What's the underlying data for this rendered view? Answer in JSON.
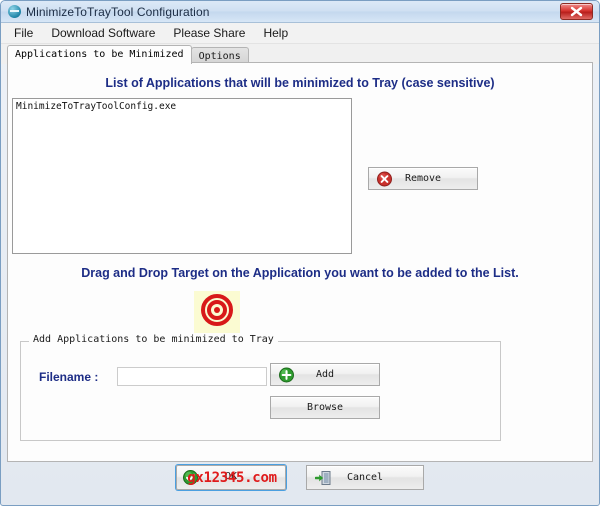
{
  "window": {
    "title": "MinimizeToTrayTool Configuration",
    "app_icon": "app-circle-icon",
    "close_icon": "close-icon"
  },
  "menubar": {
    "items": [
      {
        "label": "File"
      },
      {
        "label": "Download Software"
      },
      {
        "label": "Please Share"
      },
      {
        "label": "Help"
      }
    ]
  },
  "tabs": [
    {
      "label": "Applications to be Minimized",
      "active": true
    },
    {
      "label": "Options",
      "active": false
    }
  ],
  "main": {
    "list_heading": "List of Applications that will be minimized to Tray (case sensitive)",
    "applications": [
      "MinimizeToTrayToolConfig.exe"
    ],
    "remove_button": {
      "label": "Remove",
      "icon": "remove-circle-icon",
      "icon_color": "#c9302c"
    },
    "drag_text": "Drag and Drop Target on the Application you want to be added to the List.",
    "drop_target": {
      "icon": "bullseye-target-icon",
      "icon_color": "#d81919",
      "background": "#fbfbd2"
    },
    "group": {
      "label": "Add Applications to be minimized to Tray",
      "filename_label": "Filename :",
      "filename_value": "",
      "filename_placeholder": "",
      "add_button": {
        "label": "Add",
        "icon": "add-circle-icon",
        "icon_color": "#2e9b2e"
      },
      "browse_button": {
        "label": "Browse"
      }
    }
  },
  "footer": {
    "ok_button": {
      "label": "OK",
      "icon": "check-circle-icon",
      "icon_color": "#2e9b2e",
      "focused": true,
      "watermark": "gx12345.com",
      "watermark_color": "#e01b1b"
    },
    "cancel_button": {
      "label": "Cancel",
      "icon": "exit-door-icon",
      "icon_color": "#2e9b2e"
    }
  },
  "theme": {
    "heading_color": "#1d2d86",
    "titlebar_color": "#cfe0f2",
    "close_color": "#d6342f"
  }
}
